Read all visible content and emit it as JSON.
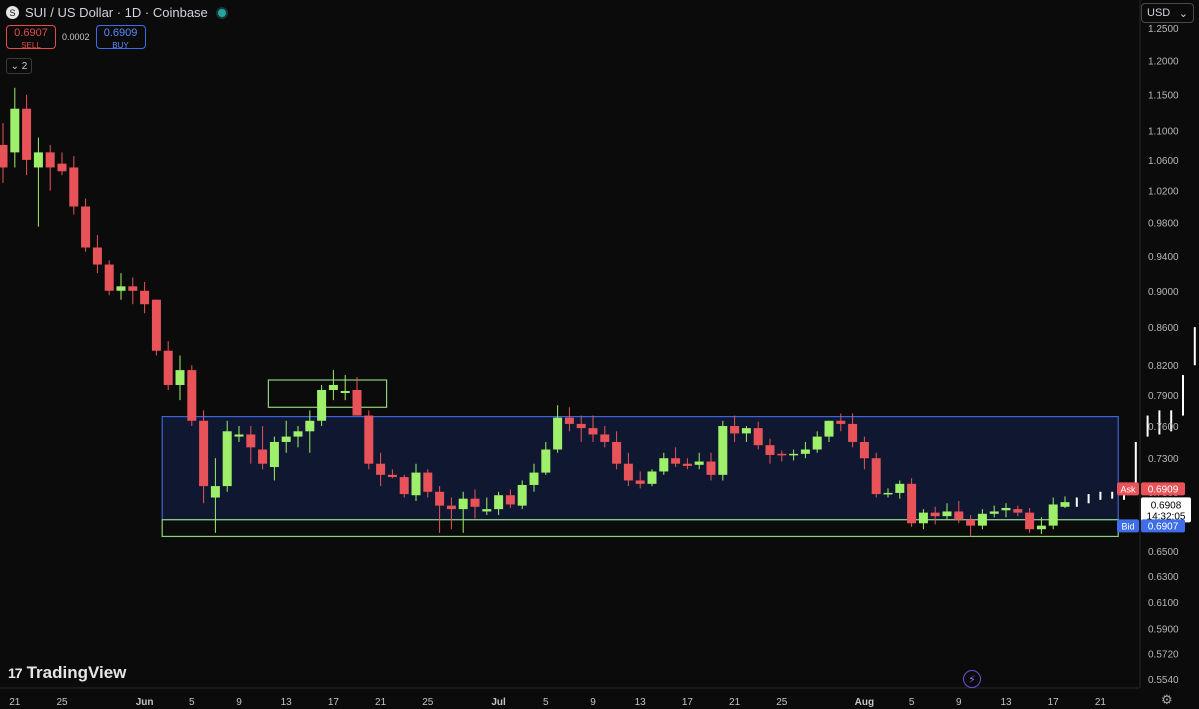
{
  "header": {
    "symbol_logo": "S",
    "title": "SUI / US Dollar · 1D · Coinbase",
    "sell_price": "0.6907",
    "sell_label": "SELL",
    "spread": "0.0002",
    "buy_price": "0.6909",
    "buy_label": "BUY",
    "collapse_label": "⌄ 2"
  },
  "currency_selector": {
    "value": "USD",
    "icon": "chevron-down-icon"
  },
  "branding": {
    "logo_mark": "17",
    "name": "TradingView"
  },
  "colors": {
    "background": "#0b0b0b",
    "up": "#9ef06a",
    "down": "#e8535a",
    "range_box": "#3f63d8",
    "range_fill": "#0f1830",
    "support_box": "#8fd17a",
    "ask": "#e8535a",
    "bid": "#3d6ee8"
  },
  "chart_data": {
    "type": "candlestick",
    "title": "SUI / US Dollar · 1D · Coinbase",
    "y_scale": "log",
    "ylim": [
      0.545,
      1.25
    ],
    "xlim": [
      "2024-05-20",
      "2024-08-23"
    ],
    "y_ticks": [
      "1.2500",
      "1.2000",
      "1.1500",
      "1.1000",
      "1.0600",
      "1.0200",
      "0.9800",
      "0.9400",
      "0.9000",
      "0.8600",
      "0.8200",
      "0.7900",
      "0.7600",
      "0.7300",
      "0.7000",
      "0.6700",
      "0.6500",
      "0.6300",
      "0.6100",
      "0.5900",
      "0.5720",
      "0.5540"
    ],
    "x_ticks": [
      {
        "date": "2024-05-21",
        "label": "21"
      },
      {
        "date": "2024-05-25",
        "label": "25"
      },
      {
        "date": "2024-06-01",
        "label": "Jun"
      },
      {
        "date": "2024-06-05",
        "label": "5"
      },
      {
        "date": "2024-06-09",
        "label": "9"
      },
      {
        "date": "2024-06-13",
        "label": "13"
      },
      {
        "date": "2024-06-17",
        "label": "17"
      },
      {
        "date": "2024-06-21",
        "label": "21"
      },
      {
        "date": "2024-06-25",
        "label": "25"
      },
      {
        "date": "2024-07-01",
        "label": "Jul"
      },
      {
        "date": "2024-07-05",
        "label": "5"
      },
      {
        "date": "2024-07-09",
        "label": "9"
      },
      {
        "date": "2024-07-13",
        "label": "13"
      },
      {
        "date": "2024-07-17",
        "label": "17"
      },
      {
        "date": "2024-07-21",
        "label": "21"
      },
      {
        "date": "2024-07-25",
        "label": "25"
      },
      {
        "date": "2024-08-01",
        "label": "Aug"
      },
      {
        "date": "2024-08-05",
        "label": "5"
      },
      {
        "date": "2024-08-09",
        "label": "9"
      },
      {
        "date": "2024-08-13",
        "label": "13"
      },
      {
        "date": "2024-08-17",
        "label": "17"
      },
      {
        "date": "2024-08-21",
        "label": "21"
      }
    ],
    "ohlc": [
      {
        "date": "2024-05-20",
        "o": 1.08,
        "h": 1.11,
        "l": 1.03,
        "c": 1.05
      },
      {
        "date": "2024-05-21",
        "o": 1.07,
        "h": 1.16,
        "l": 1.05,
        "c": 1.13
      },
      {
        "date": "2024-05-22",
        "o": 1.13,
        "h": 1.15,
        "l": 1.04,
        "c": 1.06
      },
      {
        "date": "2024-05-23",
        "o": 1.05,
        "h": 1.09,
        "l": 0.975,
        "c": 1.07
      },
      {
        "date": "2024-05-24",
        "o": 1.07,
        "h": 1.08,
        "l": 1.02,
        "c": 1.05
      },
      {
        "date": "2024-05-25",
        "o": 1.055,
        "h": 1.07,
        "l": 1.04,
        "c": 1.045
      },
      {
        "date": "2024-05-26",
        "o": 1.05,
        "h": 1.065,
        "l": 0.99,
        "c": 1.0
      },
      {
        "date": "2024-05-27",
        "o": 1.0,
        "h": 1.01,
        "l": 0.945,
        "c": 0.95
      },
      {
        "date": "2024-05-28",
        "o": 0.95,
        "h": 0.965,
        "l": 0.92,
        "c": 0.93
      },
      {
        "date": "2024-05-29",
        "o": 0.93,
        "h": 0.935,
        "l": 0.895,
        "c": 0.9
      },
      {
        "date": "2024-05-30",
        "o": 0.9,
        "h": 0.92,
        "l": 0.89,
        "c": 0.905
      },
      {
        "date": "2024-05-31",
        "o": 0.905,
        "h": 0.915,
        "l": 0.885,
        "c": 0.9
      },
      {
        "date": "2024-06-01",
        "o": 0.9,
        "h": 0.91,
        "l": 0.875,
        "c": 0.885
      },
      {
        "date": "2024-06-02",
        "o": 0.89,
        "h": 0.89,
        "l": 0.83,
        "c": 0.835
      },
      {
        "date": "2024-06-03",
        "o": 0.835,
        "h": 0.845,
        "l": 0.795,
        "c": 0.8
      },
      {
        "date": "2024-06-04",
        "o": 0.8,
        "h": 0.83,
        "l": 0.785,
        "c": 0.815
      },
      {
        "date": "2024-06-05",
        "o": 0.815,
        "h": 0.82,
        "l": 0.76,
        "c": 0.765
      },
      {
        "date": "2024-06-06",
        "o": 0.765,
        "h": 0.775,
        "l": 0.69,
        "c": 0.705
      },
      {
        "date": "2024-06-07",
        "o": 0.695,
        "h": 0.73,
        "l": 0.665,
        "c": 0.705
      },
      {
        "date": "2024-06-08",
        "o": 0.705,
        "h": 0.765,
        "l": 0.7,
        "c": 0.755
      },
      {
        "date": "2024-06-09",
        "o": 0.75,
        "h": 0.76,
        "l": 0.745,
        "c": 0.752
      },
      {
        "date": "2024-06-10",
        "o": 0.752,
        "h": 0.76,
        "l": 0.725,
        "c": 0.74
      },
      {
        "date": "2024-06-11",
        "o": 0.738,
        "h": 0.76,
        "l": 0.72,
        "c": 0.725
      },
      {
        "date": "2024-06-12",
        "o": 0.722,
        "h": 0.75,
        "l": 0.71,
        "c": 0.745
      },
      {
        "date": "2024-06-13",
        "o": 0.745,
        "h": 0.765,
        "l": 0.735,
        "c": 0.75
      },
      {
        "date": "2024-06-14",
        "o": 0.75,
        "h": 0.76,
        "l": 0.74,
        "c": 0.755
      },
      {
        "date": "2024-06-15",
        "o": 0.755,
        "h": 0.775,
        "l": 0.735,
        "c": 0.765
      },
      {
        "date": "2024-06-16",
        "o": 0.765,
        "h": 0.8,
        "l": 0.76,
        "c": 0.795
      },
      {
        "date": "2024-06-17",
        "o": 0.795,
        "h": 0.815,
        "l": 0.785,
        "c": 0.8
      },
      {
        "date": "2024-06-18",
        "o": 0.792,
        "h": 0.81,
        "l": 0.785,
        "c": 0.794
      },
      {
        "date": "2024-06-19",
        "o": 0.795,
        "h": 0.808,
        "l": 0.77,
        "c": 0.77
      },
      {
        "date": "2024-06-20",
        "o": 0.77,
        "h": 0.775,
        "l": 0.72,
        "c": 0.725
      },
      {
        "date": "2024-06-21",
        "o": 0.725,
        "h": 0.735,
        "l": 0.705,
        "c": 0.715
      },
      {
        "date": "2024-06-22",
        "o": 0.715,
        "h": 0.72,
        "l": 0.712,
        "c": 0.713
      },
      {
        "date": "2024-06-23",
        "o": 0.713,
        "h": 0.715,
        "l": 0.695,
        "c": 0.698
      },
      {
        "date": "2024-06-24",
        "o": 0.697,
        "h": 0.725,
        "l": 0.692,
        "c": 0.717
      },
      {
        "date": "2024-06-25",
        "o": 0.717,
        "h": 0.72,
        "l": 0.695,
        "c": 0.7
      },
      {
        "date": "2024-06-26",
        "o": 0.7,
        "h": 0.705,
        "l": 0.665,
        "c": 0.688
      },
      {
        "date": "2024-06-27",
        "o": 0.688,
        "h": 0.695,
        "l": 0.668,
        "c": 0.685
      },
      {
        "date": "2024-06-28",
        "o": 0.685,
        "h": 0.7,
        "l": 0.665,
        "c": 0.694
      },
      {
        "date": "2024-06-29",
        "o": 0.694,
        "h": 0.702,
        "l": 0.677,
        "c": 0.687
      },
      {
        "date": "2024-06-30",
        "o": 0.683,
        "h": 0.695,
        "l": 0.68,
        "c": 0.685
      },
      {
        "date": "2024-07-01",
        "o": 0.685,
        "h": 0.7,
        "l": 0.68,
        "c": 0.697
      },
      {
        "date": "2024-07-02",
        "o": 0.697,
        "h": 0.702,
        "l": 0.686,
        "c": 0.689
      },
      {
        "date": "2024-07-03",
        "o": 0.688,
        "h": 0.71,
        "l": 0.685,
        "c": 0.706
      },
      {
        "date": "2024-07-04",
        "o": 0.706,
        "h": 0.725,
        "l": 0.7,
        "c": 0.717
      },
      {
        "date": "2024-07-05",
        "o": 0.717,
        "h": 0.745,
        "l": 0.715,
        "c": 0.738
      },
      {
        "date": "2024-07-06",
        "o": 0.738,
        "h": 0.78,
        "l": 0.735,
        "c": 0.768
      },
      {
        "date": "2024-07-07",
        "o": 0.768,
        "h": 0.778,
        "l": 0.755,
        "c": 0.762
      },
      {
        "date": "2024-07-08",
        "o": 0.762,
        "h": 0.77,
        "l": 0.745,
        "c": 0.758
      },
      {
        "date": "2024-07-09",
        "o": 0.758,
        "h": 0.77,
        "l": 0.745,
        "c": 0.752
      },
      {
        "date": "2024-07-10",
        "o": 0.752,
        "h": 0.76,
        "l": 0.74,
        "c": 0.745
      },
      {
        "date": "2024-07-11",
        "o": 0.745,
        "h": 0.755,
        "l": 0.72,
        "c": 0.725
      },
      {
        "date": "2024-07-12",
        "o": 0.725,
        "h": 0.735,
        "l": 0.705,
        "c": 0.71
      },
      {
        "date": "2024-07-13",
        "o": 0.71,
        "h": 0.718,
        "l": 0.703,
        "c": 0.707
      },
      {
        "date": "2024-07-14",
        "o": 0.707,
        "h": 0.72,
        "l": 0.705,
        "c": 0.718
      },
      {
        "date": "2024-07-15",
        "o": 0.718,
        "h": 0.735,
        "l": 0.715,
        "c": 0.73
      },
      {
        "date": "2024-07-16",
        "o": 0.73,
        "h": 0.74,
        "l": 0.722,
        "c": 0.725
      },
      {
        "date": "2024-07-17",
        "o": 0.725,
        "h": 0.73,
        "l": 0.72,
        "c": 0.723
      },
      {
        "date": "2024-07-18",
        "o": 0.724,
        "h": 0.735,
        "l": 0.72,
        "c": 0.727
      },
      {
        "date": "2024-07-19",
        "o": 0.727,
        "h": 0.735,
        "l": 0.71,
        "c": 0.715
      },
      {
        "date": "2024-07-20",
        "o": 0.715,
        "h": 0.765,
        "l": 0.71,
        "c": 0.76
      },
      {
        "date": "2024-07-21",
        "o": 0.76,
        "h": 0.77,
        "l": 0.745,
        "c": 0.753
      },
      {
        "date": "2024-07-22",
        "o": 0.753,
        "h": 0.76,
        "l": 0.745,
        "c": 0.758
      },
      {
        "date": "2024-07-23",
        "o": 0.758,
        "h": 0.764,
        "l": 0.738,
        "c": 0.742
      },
      {
        "date": "2024-07-24",
        "o": 0.742,
        "h": 0.748,
        "l": 0.725,
        "c": 0.733
      },
      {
        "date": "2024-07-25",
        "o": 0.734,
        "h": 0.737,
        "l": 0.727,
        "c": 0.733
      },
      {
        "date": "2024-07-26",
        "o": 0.733,
        "h": 0.738,
        "l": 0.728,
        "c": 0.734
      },
      {
        "date": "2024-07-27",
        "o": 0.734,
        "h": 0.745,
        "l": 0.73,
        "c": 0.738
      },
      {
        "date": "2024-07-28",
        "o": 0.738,
        "h": 0.755,
        "l": 0.735,
        "c": 0.75
      },
      {
        "date": "2024-07-29",
        "o": 0.75,
        "h": 0.765,
        "l": 0.745,
        "c": 0.765
      },
      {
        "date": "2024-07-30",
        "o": 0.765,
        "h": 0.772,
        "l": 0.755,
        "c": 0.762
      },
      {
        "date": "2024-07-31",
        "o": 0.762,
        "h": 0.772,
        "l": 0.74,
        "c": 0.745
      },
      {
        "date": "2024-08-01",
        "o": 0.745,
        "h": 0.75,
        "l": 0.72,
        "c": 0.73
      },
      {
        "date": "2024-08-02",
        "o": 0.73,
        "h": 0.735,
        "l": 0.695,
        "c": 0.698
      },
      {
        "date": "2024-08-03",
        "o": 0.699,
        "h": 0.703,
        "l": 0.695,
        "c": 0.699
      },
      {
        "date": "2024-08-04",
        "o": 0.699,
        "h": 0.71,
        "l": 0.694,
        "c": 0.707
      },
      {
        "date": "2024-08-05",
        "o": 0.707,
        "h": 0.712,
        "l": 0.67,
        "c": 0.673
      },
      {
        "date": "2024-08-06",
        "o": 0.673,
        "h": 0.685,
        "l": 0.668,
        "c": 0.682
      },
      {
        "date": "2024-08-07",
        "o": 0.682,
        "h": 0.687,
        "l": 0.672,
        "c": 0.679
      },
      {
        "date": "2024-08-08",
        "o": 0.679,
        "h": 0.69,
        "l": 0.676,
        "c": 0.683
      },
      {
        "date": "2024-08-09",
        "o": 0.683,
        "h": 0.692,
        "l": 0.673,
        "c": 0.676
      },
      {
        "date": "2024-08-10",
        "o": 0.676,
        "h": 0.68,
        "l": 0.662,
        "c": 0.671
      },
      {
        "date": "2024-08-11",
        "o": 0.671,
        "h": 0.685,
        "l": 0.668,
        "c": 0.681
      },
      {
        "date": "2024-08-12",
        "o": 0.681,
        "h": 0.688,
        "l": 0.678,
        "c": 0.683
      },
      {
        "date": "2024-08-13",
        "o": 0.684,
        "h": 0.69,
        "l": 0.678,
        "c": 0.686
      },
      {
        "date": "2024-08-14",
        "o": 0.685,
        "h": 0.688,
        "l": 0.679,
        "c": 0.682
      },
      {
        "date": "2024-08-15",
        "o": 0.682,
        "h": 0.686,
        "l": 0.665,
        "c": 0.668
      },
      {
        "date": "2024-08-16",
        "o": 0.668,
        "h": 0.678,
        "l": 0.664,
        "c": 0.671
      },
      {
        "date": "2024-08-17",
        "o": 0.671,
        "h": 0.695,
        "l": 0.668,
        "c": 0.689
      },
      {
        "date": "2024-08-18",
        "o": 0.687,
        "h": 0.696,
        "l": 0.686,
        "c": 0.691
      }
    ],
    "projection_bars": [
      {
        "date": "2024-08-19",
        "h": 0.695,
        "l": 0.687
      },
      {
        "date": "2024-08-20",
        "h": 0.698,
        "l": 0.69
      },
      {
        "date": "2024-08-21",
        "h": 0.7,
        "l": 0.693
      },
      {
        "date": "2024-08-22",
        "h": 0.7,
        "l": 0.694
      },
      {
        "date": "2024-08-23",
        "h": 0.7,
        "l": 0.693
      },
      {
        "date": "2024-08-24",
        "h": 0.745,
        "l": 0.703
      },
      {
        "date": "2024-08-25",
        "h": 0.77,
        "l": 0.75
      },
      {
        "date": "2024-08-26",
        "h": 0.775,
        "l": 0.752
      },
      {
        "date": "2024-08-27",
        "h": 0.775,
        "l": 0.755
      },
      {
        "date": "2024-08-28",
        "h": 0.81,
        "l": 0.77
      },
      {
        "date": "2024-08-29",
        "h": 0.86,
        "l": 0.82
      },
      {
        "date": "2024-08-30",
        "h": 1.2,
        "l": 0.865
      }
    ],
    "zones": [
      {
        "name": "range",
        "x0": "2024-06-03",
        "x1": "2024-08-22",
        "y0": 0.676,
        "y1": 0.769,
        "color": "#3f63d8"
      },
      {
        "name": "support",
        "x0": "2024-06-03",
        "x1": "2024-08-22",
        "y0": 0.662,
        "y1": 0.676,
        "color": "#8fd17a"
      },
      {
        "name": "breakout",
        "x0": "2024-06-12",
        "x1": "2024-06-21",
        "y0": 0.778,
        "y1": 0.805,
        "color": "#8fd17a"
      }
    ],
    "price_labels": {
      "ask_label": "Ask",
      "ask_price": "0.6909",
      "last_price": "0.6908",
      "countdown": "14:32:05",
      "bid_label": "Bid",
      "bid_price": "0.6907"
    }
  }
}
